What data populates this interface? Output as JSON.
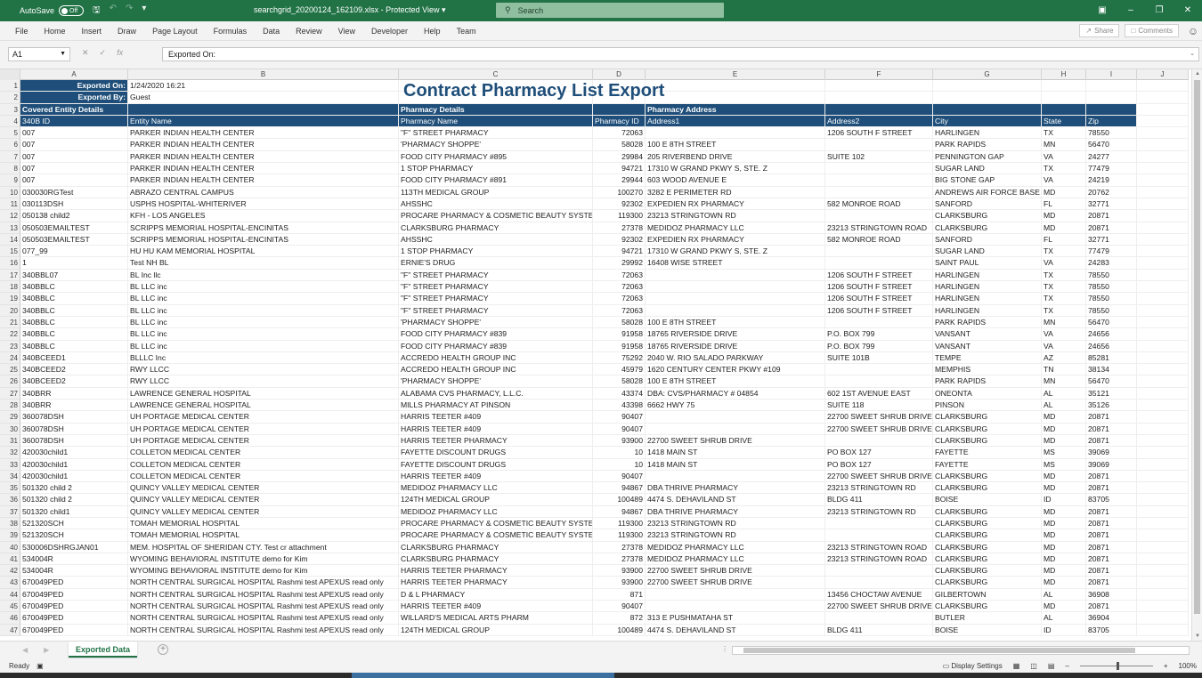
{
  "titlebar": {
    "autosave_label": "AutoSave",
    "autosave_state": "Off",
    "filename": "searchgrid_20200124_162109.xlsx",
    "protected": "Protected View",
    "search_placeholder": "Search"
  },
  "ribbon": {
    "tabs": [
      "File",
      "Home",
      "Insert",
      "Draw",
      "Page Layout",
      "Formulas",
      "Data",
      "Review",
      "View",
      "Developer",
      "Help",
      "Team"
    ],
    "share": "Share",
    "comments": "Comments"
  },
  "formula_bar": {
    "cell_ref": "A1",
    "content": "Exported On:"
  },
  "columns": [
    "A",
    "B",
    "C",
    "D",
    "E",
    "F",
    "G",
    "H",
    "I",
    "J"
  ],
  "sheet": {
    "title": "Contract Pharmacy List Export",
    "exported_on_label": "Exported On:",
    "exported_on_value": "1/24/2020 16:21",
    "exported_by_label": "Exported By:",
    "exported_by_value": "Guest",
    "group_headers": [
      "Covered Entity Details",
      "Pharmacy Details",
      "Pharmacy Address"
    ],
    "headers": [
      "340B ID",
      "Entity Name",
      "Pharmacy Name",
      "Pharmacy ID",
      "Address1",
      "Address2",
      "City",
      "State",
      "Zip"
    ],
    "rows": [
      [
        "007",
        "PARKER INDIAN HEALTH CENTER",
        "\"F\" STREET PHARMACY",
        "72063",
        "",
        "1206 SOUTH F STREET",
        "HARLINGEN",
        "TX",
        "78550"
      ],
      [
        "007",
        "PARKER INDIAN HEALTH CENTER",
        "'PHARMACY SHOPPE'",
        "58028",
        "100 E 8TH STREET",
        "",
        "PARK RAPIDS",
        "MN",
        "56470"
      ],
      [
        "007",
        "PARKER INDIAN HEALTH CENTER",
        "FOOD CITY PHARMACY #895",
        "29984",
        "205 RIVERBEND DRIVE",
        "SUITE 102",
        "PENNINGTON GAP",
        "VA",
        "24277"
      ],
      [
        "007",
        "PARKER INDIAN HEALTH CENTER",
        "1 STOP PHARMACY",
        "94721",
        "17310 W GRAND PKWY S, STE. Z",
        "",
        "SUGAR LAND",
        "TX",
        "77479"
      ],
      [
        "007",
        "PARKER INDIAN HEALTH CENTER",
        "FOOD CITY PHARMACY #891",
        "29944",
        "603 WOOD AVENUE E",
        "",
        "BIG STONE GAP",
        "VA",
        "24219"
      ],
      [
        "030030RGTest",
        "ABRAZO CENTRAL CAMPUS",
        "113TH MEDICAL GROUP",
        "100270",
        "3282 E PERIMETER RD",
        "",
        "ANDREWS AIR FORCE BASE",
        "MD",
        "20762"
      ],
      [
        "030113DSH",
        "USPHS HOSPITAL-WHITERIVER",
        "AHSSHC",
        "92302",
        "EXPEDIEN RX PHARMACY",
        "582 MONROE ROAD",
        "SANFORD",
        "FL",
        "32771"
      ],
      [
        "050138 child2",
        "KFH - LOS ANGELES",
        "PROCARE PHARMACY & COSMETIC BEAUTY SYSTE",
        "119300",
        "23213 STRINGTOWN RD",
        "",
        "CLARKSBURG",
        "MD",
        "20871"
      ],
      [
        "050503EMAILTEST",
        "SCRIPPS MEMORIAL HOSPITAL-ENCINITAS",
        "CLARKSBURG PHARMACY",
        "27378",
        "MEDIDOZ PHARMACY LLC",
        "23213 STRINGTOWN ROAD",
        "CLARKSBURG",
        "MD",
        "20871"
      ],
      [
        "050503EMAILTEST",
        "SCRIPPS MEMORIAL HOSPITAL-ENCINITAS",
        "AHSSHC",
        "92302",
        "EXPEDIEN RX PHARMACY",
        "582 MONROE ROAD",
        "SANFORD",
        "FL",
        "32771"
      ],
      [
        "077_99",
        "HU HU KAM MEMORIAL HOSPITAL",
        "1 STOP PHARMACY",
        "94721",
        "17310 W GRAND PKWY S, STE. Z",
        "",
        "SUGAR LAND",
        "TX",
        "77479"
      ],
      [
        "1",
        "Test NH BL",
        "ERNIE'S DRUG",
        "29992",
        "16408 WISE STREET",
        "",
        "SAINT PAUL",
        "VA",
        "24283"
      ],
      [
        "340BBL07",
        "BL Inc llc",
        "\"F\" STREET PHARMACY",
        "72063",
        "",
        "1206 SOUTH F STREET",
        "HARLINGEN",
        "TX",
        "78550"
      ],
      [
        "340BBLC",
        "BL LLC inc",
        "\"F\" STREET PHARMACY",
        "72063",
        "",
        "1206 SOUTH F STREET",
        "HARLINGEN",
        "TX",
        "78550"
      ],
      [
        "340BBLC",
        "BL LLC inc",
        "\"F\" STREET PHARMACY",
        "72063",
        "",
        "1206 SOUTH F STREET",
        "HARLINGEN",
        "TX",
        "78550"
      ],
      [
        "340BBLC",
        "BL LLC inc",
        "\"F\" STREET PHARMACY",
        "72063",
        "",
        "1206 SOUTH F STREET",
        "HARLINGEN",
        "TX",
        "78550"
      ],
      [
        "340BBLC",
        "BL LLC inc",
        "'PHARMACY SHOPPE'",
        "58028",
        "100 E 8TH STREET",
        "",
        "PARK RAPIDS",
        "MN",
        "56470"
      ],
      [
        "340BBLC",
        "BL LLC inc",
        "FOOD CITY PHARMACY #839",
        "91958",
        "18765 RIVERSIDE DRIVE",
        "P.O. BOX 799",
        "VANSANT",
        "VA",
        "24656"
      ],
      [
        "340BBLC",
        "BL LLC inc",
        "FOOD CITY PHARMACY #839",
        "91958",
        "18765 RIVERSIDE DRIVE",
        "P.O. BOX 799",
        "VANSANT",
        "VA",
        "24656"
      ],
      [
        "340BCEED1",
        "BLLLC Inc",
        "ACCREDO HEALTH GROUP INC",
        "75292",
        "2040 W. RIO SALADO PARKWAY",
        "SUITE 101B",
        "TEMPE",
        "AZ",
        "85281"
      ],
      [
        "340BCEED2",
        "RWY LLCC",
        "ACCREDO HEALTH GROUP INC",
        "45979",
        "1620 CENTURY CENTER PKWY #109",
        "",
        "MEMPHIS",
        "TN",
        "38134"
      ],
      [
        "340BCEED2",
        "RWY LLCC",
        "'PHARMACY SHOPPE'",
        "58028",
        "100 E 8TH STREET",
        "",
        "PARK RAPIDS",
        "MN",
        "56470"
      ],
      [
        "340BRR",
        "LAWRENCE GENERAL HOSPITAL",
        "ALABAMA CVS PHARMACY, L.L.C.",
        "43374",
        "DBA: CVS/PHARMACY  # 04854",
        "602 1ST AVENUE EAST",
        "ONEONTA",
        "AL",
        "35121"
      ],
      [
        "340BRR",
        "LAWRENCE GENERAL HOSPITAL",
        "MILLS PHARMACY AT PINSON",
        "43398",
        "6662 HWY 75",
        "SUITE 118",
        "PINSON",
        "AL",
        "35126"
      ],
      [
        "360078DSH",
        "UH PORTAGE MEDICAL CENTER",
        "HARRIS TEETER #409",
        "90407",
        "",
        "22700 SWEET SHRUB DRIVE",
        "CLARKSBURG",
        "MD",
        "20871"
      ],
      [
        "360078DSH",
        "UH PORTAGE MEDICAL CENTER",
        "HARRIS TEETER #409",
        "90407",
        "",
        "22700 SWEET SHRUB DRIVE",
        "CLARKSBURG",
        "MD",
        "20871"
      ],
      [
        "360078DSH",
        "UH PORTAGE MEDICAL CENTER",
        "HARRIS TEETER PHARMACY",
        "93900",
        "22700 SWEET SHRUB DRIVE",
        "",
        "CLARKSBURG",
        "MD",
        "20871"
      ],
      [
        "420030child1",
        "COLLETON MEDICAL CENTER",
        "FAYETTE DISCOUNT DRUGS",
        "10",
        "1418 MAIN ST",
        "PO BOX 127",
        "FAYETTE",
        "MS",
        "39069"
      ],
      [
        "420030child1",
        "COLLETON MEDICAL CENTER",
        "FAYETTE DISCOUNT DRUGS",
        "10",
        "1418 MAIN ST",
        "PO BOX 127",
        "FAYETTE",
        "MS",
        "39069"
      ],
      [
        "420030child1",
        "COLLETON MEDICAL CENTER",
        "HARRIS TEETER #409",
        "90407",
        "",
        "22700 SWEET SHRUB DRIVE",
        "CLARKSBURG",
        "MD",
        "20871"
      ],
      [
        "501320 child 2",
        "QUINCY VALLEY MEDICAL CENTER",
        "MEDIDOZ PHARMACY LLC",
        "94867",
        "DBA THRIVE PHARMACY",
        "23213 STRINGTOWN RD",
        "CLARKSBURG",
        "MD",
        "20871"
      ],
      [
        "501320 child 2",
        "QUINCY VALLEY MEDICAL CENTER",
        "124TH MEDICAL GROUP",
        "100489",
        "4474 S. DEHAVILAND ST",
        "BLDG 411",
        "BOISE",
        "ID",
        "83705"
      ],
      [
        "501320 child1",
        "QUINCY VALLEY MEDICAL CENTER",
        "MEDIDOZ PHARMACY LLC",
        "94867",
        "DBA THRIVE PHARMACY",
        "23213 STRINGTOWN RD",
        "CLARKSBURG",
        "MD",
        "20871"
      ],
      [
        "521320SCH",
        "TOMAH MEMORIAL HOSPITAL",
        "PROCARE PHARMACY & COSMETIC BEAUTY SYSTE",
        "119300",
        "23213 STRINGTOWN RD",
        "",
        "CLARKSBURG",
        "MD",
        "20871"
      ],
      [
        "521320SCH",
        "TOMAH MEMORIAL HOSPITAL",
        "PROCARE PHARMACY & COSMETIC BEAUTY SYSTE",
        "119300",
        "23213 STRINGTOWN RD",
        "",
        "CLARKSBURG",
        "MD",
        "20871"
      ],
      [
        "530006DSHRGJAN01",
        "MEM. HOSPITAL OF SHERIDAN CTY. Test cr attachment",
        "CLARKSBURG PHARMACY",
        "27378",
        "MEDIDOZ PHARMACY LLC",
        "23213 STRINGTOWN ROAD",
        "CLARKSBURG",
        "MD",
        "20871"
      ],
      [
        "534004R",
        "WYOMING BEHAVIORAL INSTITUTE demo for Kim",
        "CLARKSBURG PHARMACY",
        "27378",
        "MEDIDOZ PHARMACY LLC",
        "23213 STRINGTOWN ROAD",
        "CLARKSBURG",
        "MD",
        "20871"
      ],
      [
        "534004R",
        "WYOMING BEHAVIORAL INSTITUTE demo for Kim",
        "HARRIS TEETER PHARMACY",
        "93900",
        "22700 SWEET SHRUB DRIVE",
        "",
        "CLARKSBURG",
        "MD",
        "20871"
      ],
      [
        "670049PED",
        "NORTH CENTRAL SURGICAL HOSPITAL Rashmi test APEXUS read only",
        "HARRIS TEETER PHARMACY",
        "93900",
        "22700 SWEET SHRUB DRIVE",
        "",
        "CLARKSBURG",
        "MD",
        "20871"
      ],
      [
        "670049PED",
        "NORTH CENTRAL SURGICAL HOSPITAL Rashmi test APEXUS read only",
        "D & L PHARMACY",
        "871",
        "",
        "13456 CHOCTAW AVENUE",
        "GILBERTOWN",
        "AL",
        "36908"
      ],
      [
        "670049PED",
        "NORTH CENTRAL SURGICAL HOSPITAL Rashmi test APEXUS read only",
        "HARRIS TEETER #409",
        "90407",
        "",
        "22700 SWEET SHRUB DRIVE",
        "CLARKSBURG",
        "MD",
        "20871"
      ],
      [
        "670049PED",
        "NORTH CENTRAL SURGICAL HOSPITAL Rashmi test APEXUS read only",
        "WILLARD'S MEDICAL ARTS PHARM",
        "872",
        "313 E PUSHMATAHA ST",
        "",
        "BUTLER",
        "AL",
        "36904"
      ],
      [
        "670049PED",
        "NORTH CENTRAL SURGICAL HOSPITAL Rashmi test APEXUS read only",
        "124TH MEDICAL GROUP",
        "100489",
        "4474 S. DEHAVILAND ST",
        "BLDG 411",
        "BOISE",
        "ID",
        "83705"
      ]
    ]
  },
  "sheet_tab": "Exported Data",
  "status": {
    "ready": "Ready",
    "display_settings": "Display Settings",
    "zoom": "100%"
  }
}
